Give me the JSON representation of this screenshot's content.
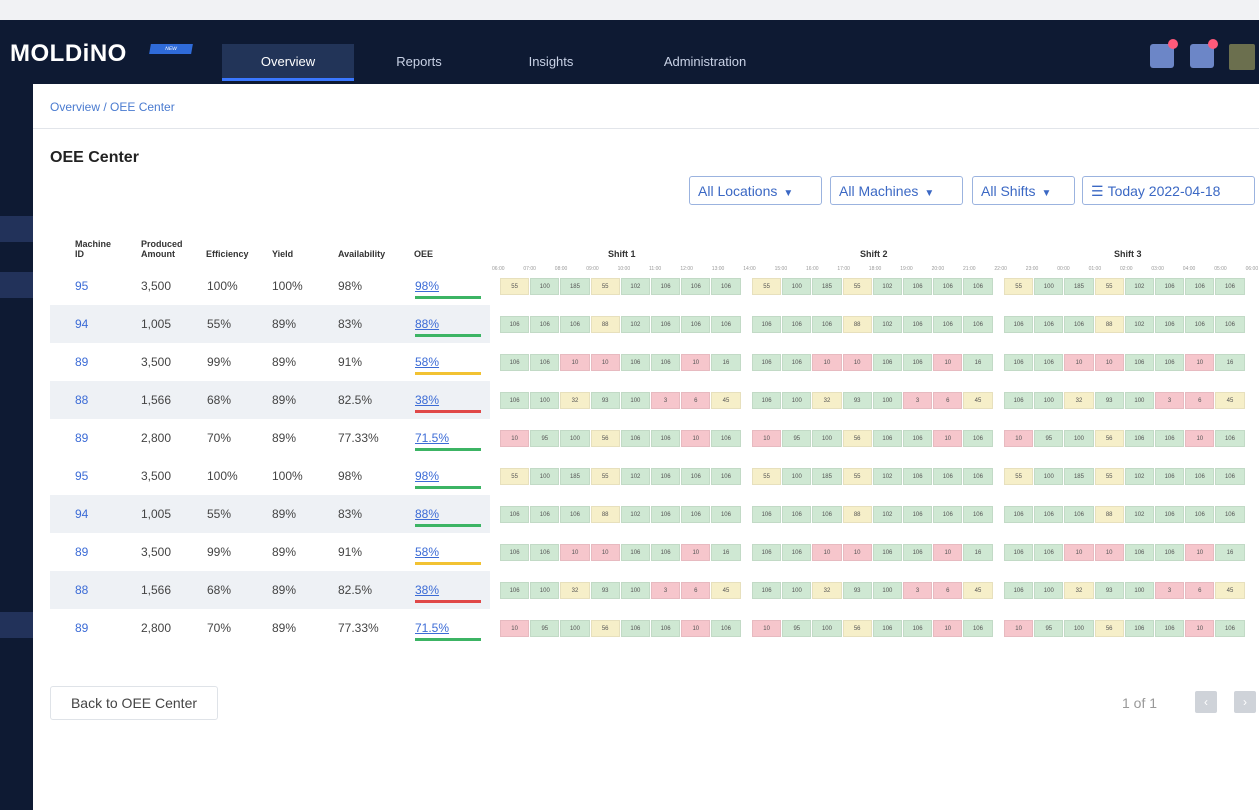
{
  "app": {
    "logo": "MOLDiNO",
    "logo_badge": "NEW"
  },
  "nav": {
    "tabs": [
      {
        "label": "Overview",
        "active": true
      },
      {
        "label": "Reports",
        "active": false
      },
      {
        "label": "Insights",
        "active": false
      },
      {
        "label": "Administration",
        "active": false
      }
    ]
  },
  "breadcrumb": "Overview / OEE Center",
  "page_title": "OEE Center",
  "filters": {
    "locations": "All Locations",
    "machines": "All Machines",
    "shifts": "All Shifts",
    "date": "Today 2022-04-18"
  },
  "table": {
    "headers": {
      "machine_id": [
        "Machine",
        "ID"
      ],
      "produced": [
        "Produced",
        "Amount"
      ],
      "efficiency": "Efficiency",
      "yield": "Yield",
      "availability": "Availability",
      "oee": "OEE"
    },
    "shifts": [
      "Shift 1",
      "Shift 2",
      "Shift 3"
    ],
    "hours": [
      "06:00",
      "07:00",
      "08:00",
      "09:00",
      "10:00",
      "11:00",
      "12:00",
      "13:00",
      "14:00",
      "15:00",
      "16:00",
      "17:00",
      "18:00",
      "19:00",
      "20:00",
      "21:00",
      "22:00",
      "23:00",
      "00:00",
      "01:00",
      "02:00",
      "03:00",
      "04:00",
      "05:00",
      "06:00"
    ],
    "rows": [
      {
        "id": "95",
        "produced": "3,500",
        "efficiency": "100%",
        "yield": "100%",
        "availability": "98%",
        "oee": "98%",
        "oee_status": "good",
        "shaded": false,
        "cells": [
          [
            "55",
            "y"
          ],
          [
            "100",
            "g"
          ],
          [
            "185",
            "g"
          ],
          [
            "55",
            "y"
          ],
          [
            "102",
            "g"
          ],
          [
            "106",
            "g"
          ],
          [
            "106",
            "g"
          ],
          [
            "106",
            "g"
          ]
        ]
      },
      {
        "id": "94",
        "produced": "1,005",
        "efficiency": "55%",
        "yield": "89%",
        "availability": "83%",
        "oee": "88%",
        "oee_status": "good",
        "shaded": true,
        "cells": [
          [
            "106",
            "g"
          ],
          [
            "106",
            "g"
          ],
          [
            "106",
            "g"
          ],
          [
            "88",
            "y"
          ],
          [
            "102",
            "g"
          ],
          [
            "106",
            "g"
          ],
          [
            "106",
            "g"
          ],
          [
            "106",
            "g"
          ]
        ]
      },
      {
        "id": "89",
        "produced": "3,500",
        "efficiency": "99%",
        "yield": "89%",
        "availability": "91%",
        "oee": "58%",
        "oee_status": "warn",
        "shaded": false,
        "cells": [
          [
            "106",
            "g"
          ],
          [
            "106",
            "g"
          ],
          [
            "10",
            "r"
          ],
          [
            "10",
            "r"
          ],
          [
            "106",
            "g"
          ],
          [
            "106",
            "g"
          ],
          [
            "10",
            "r"
          ],
          [
            "16",
            "g"
          ]
        ]
      },
      {
        "id": "88",
        "produced": "1,566",
        "efficiency": "68%",
        "yield": "89%",
        "availability": "82.5%",
        "oee": "38%",
        "oee_status": "bad",
        "shaded": true,
        "cells": [
          [
            "106",
            "g"
          ],
          [
            "100",
            "g"
          ],
          [
            "32",
            "y"
          ],
          [
            "93",
            "g"
          ],
          [
            "100",
            "g"
          ],
          [
            "3",
            "r"
          ],
          [
            "6",
            "r"
          ],
          [
            "45",
            "y"
          ]
        ]
      },
      {
        "id": "89",
        "produced": "2,800",
        "efficiency": "70%",
        "yield": "89%",
        "availability": "77.33%",
        "oee": "71.5%",
        "oee_status": "good",
        "shaded": false,
        "cells": [
          [
            "10",
            "r"
          ],
          [
            "95",
            "g"
          ],
          [
            "100",
            "g"
          ],
          [
            "56",
            "y"
          ],
          [
            "106",
            "g"
          ],
          [
            "106",
            "g"
          ],
          [
            "10",
            "r"
          ],
          [
            "106",
            "g"
          ]
        ]
      },
      {
        "id": "95",
        "produced": "3,500",
        "efficiency": "100%",
        "yield": "100%",
        "availability": "98%",
        "oee": "98%",
        "oee_status": "good",
        "shaded": false,
        "cells": [
          [
            "55",
            "y"
          ],
          [
            "100",
            "g"
          ],
          [
            "185",
            "g"
          ],
          [
            "55",
            "y"
          ],
          [
            "102",
            "g"
          ],
          [
            "106",
            "g"
          ],
          [
            "106",
            "g"
          ],
          [
            "106",
            "g"
          ]
        ]
      },
      {
        "id": "94",
        "produced": "1,005",
        "efficiency": "55%",
        "yield": "89%",
        "availability": "83%",
        "oee": "88%",
        "oee_status": "good",
        "shaded": true,
        "cells": [
          [
            "106",
            "g"
          ],
          [
            "106",
            "g"
          ],
          [
            "106",
            "g"
          ],
          [
            "88",
            "y"
          ],
          [
            "102",
            "g"
          ],
          [
            "106",
            "g"
          ],
          [
            "106",
            "g"
          ],
          [
            "106",
            "g"
          ]
        ]
      },
      {
        "id": "89",
        "produced": "3,500",
        "efficiency": "99%",
        "yield": "89%",
        "availability": "91%",
        "oee": "58%",
        "oee_status": "warn",
        "shaded": false,
        "cells": [
          [
            "106",
            "g"
          ],
          [
            "106",
            "g"
          ],
          [
            "10",
            "r"
          ],
          [
            "10",
            "r"
          ],
          [
            "106",
            "g"
          ],
          [
            "106",
            "g"
          ],
          [
            "10",
            "r"
          ],
          [
            "16",
            "g"
          ]
        ]
      },
      {
        "id": "88",
        "produced": "1,566",
        "efficiency": "68%",
        "yield": "89%",
        "availability": "82.5%",
        "oee": "38%",
        "oee_status": "bad",
        "shaded": true,
        "cells": [
          [
            "106",
            "g"
          ],
          [
            "100",
            "g"
          ],
          [
            "32",
            "y"
          ],
          [
            "93",
            "g"
          ],
          [
            "100",
            "g"
          ],
          [
            "3",
            "r"
          ],
          [
            "6",
            "r"
          ],
          [
            "45",
            "y"
          ]
        ]
      },
      {
        "id": "89",
        "produced": "2,800",
        "efficiency": "70%",
        "yield": "89%",
        "availability": "77.33%",
        "oee": "71.5%",
        "oee_status": "good",
        "shaded": false,
        "cells": [
          [
            "10",
            "r"
          ],
          [
            "95",
            "g"
          ],
          [
            "100",
            "g"
          ],
          [
            "56",
            "y"
          ],
          [
            "106",
            "g"
          ],
          [
            "106",
            "g"
          ],
          [
            "10",
            "r"
          ],
          [
            "106",
            "g"
          ]
        ]
      }
    ]
  },
  "colors": {
    "g": "#cfe8d3",
    "y": "#f6efc9",
    "r": "#f6c6cc",
    "good": "#3cb464",
    "warn": "#f2c232",
    "bad": "#e04848",
    "accent": "#3b6bd6",
    "nav_bg": "#0e1a33"
  },
  "footer": {
    "back_button": "Back to OEE Center",
    "pager": "1 of 1",
    "prev_icon": "chevron-left-icon",
    "next_icon": "chevron-right-icon"
  }
}
